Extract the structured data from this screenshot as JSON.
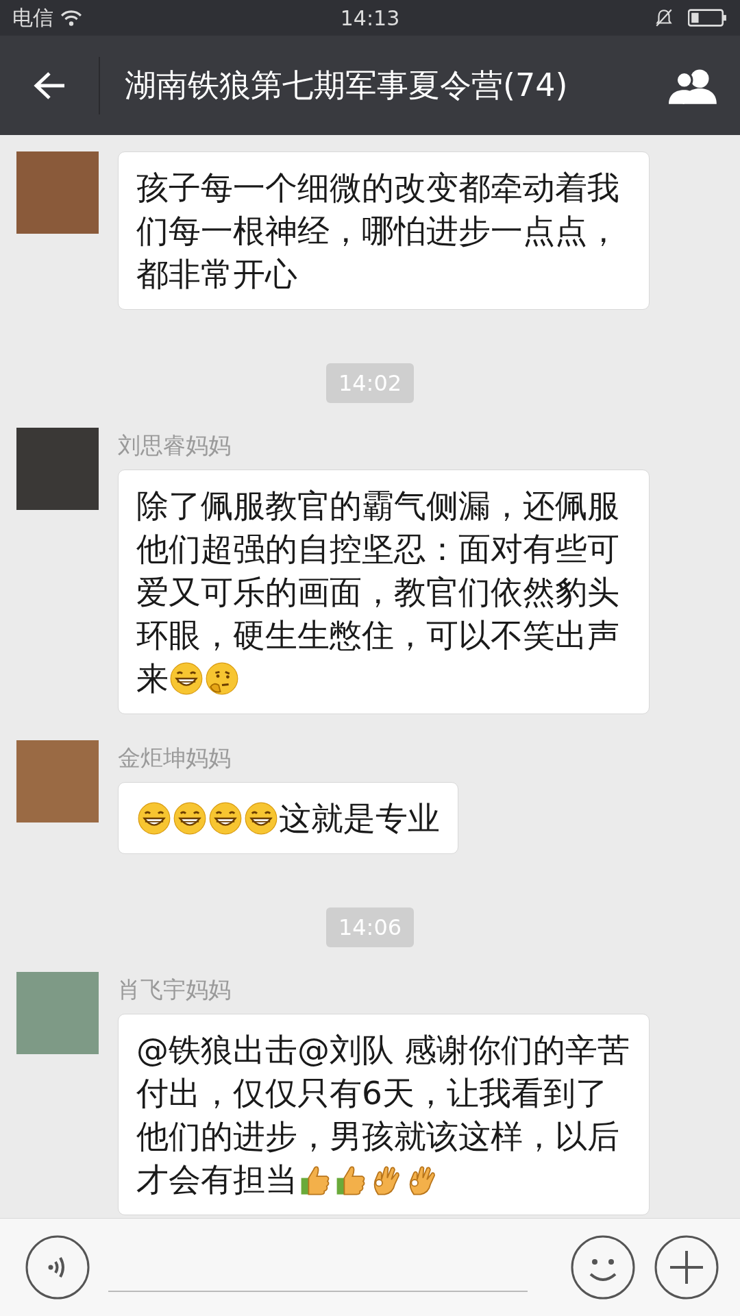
{
  "status_bar": {
    "carrier": "电信",
    "time": "14:13"
  },
  "header": {
    "title": "湖南铁狼第七期军事夏令营(74)"
  },
  "messages": [
    {
      "kind": "message",
      "content": [
        {
          "kind": "text",
          "text": "孩子每一个细微的改变都牵动着我们每一根神经，哪怕进步一点点，都非常开心"
        }
      ]
    },
    {
      "kind": "time",
      "text": "14:02"
    },
    {
      "kind": "message",
      "sender": "刘思睿妈妈",
      "content": [
        {
          "kind": "text",
          "text": "除了佩服教官的霸气侧漏，还佩服他们超强的自控坚忍：面对有些可爱又可乐的画面，教官们依然豹头环眼，硬生生憋住，可以不笑出声来"
        },
        {
          "kind": "grin"
        },
        {
          "kind": "thinking"
        }
      ]
    },
    {
      "kind": "message",
      "sender": "金炬坤妈妈",
      "content": [
        {
          "kind": "grin"
        },
        {
          "kind": "grin"
        },
        {
          "kind": "grin"
        },
        {
          "kind": "grin"
        },
        {
          "kind": "text",
          "text": "这就是专业"
        }
      ]
    },
    {
      "kind": "time",
      "text": "14:06"
    },
    {
      "kind": "message",
      "sender": "肖飞宇妈妈",
      "content": [
        {
          "kind": "text",
          "text": "@铁狼出击@刘队 感谢你们的辛苦付出，仅仅只有6天，让我看到了他们的进步，男孩就该这样，以后才会有担当"
        },
        {
          "kind": "thumbs"
        },
        {
          "kind": "thumbs"
        },
        {
          "kind": "ok"
        },
        {
          "kind": "ok"
        }
      ]
    }
  ]
}
